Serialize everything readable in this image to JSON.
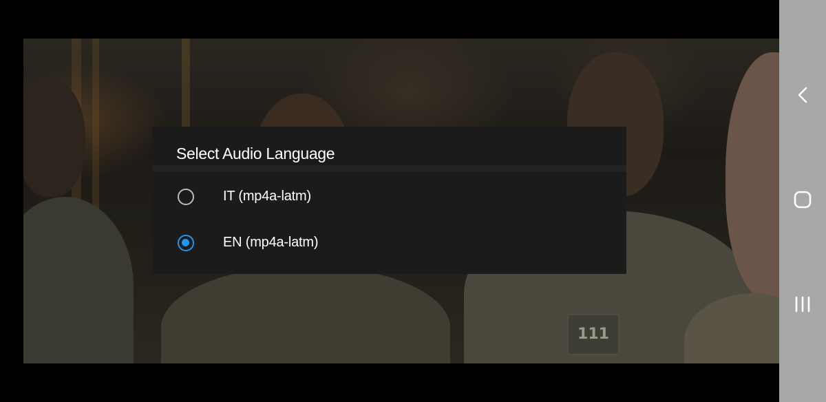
{
  "dialog": {
    "title": "Select Audio Language",
    "options": [
      {
        "label": "IT (mp4a-latm)",
        "selected": false
      },
      {
        "label": "EN (mp4a-latm)",
        "selected": true
      }
    ]
  },
  "video": {
    "overlay_text": "111"
  },
  "navbar": {
    "back_icon": "back-chevron-icon",
    "home_icon": "home-square-icon",
    "recents_icon": "recents-bars-icon"
  },
  "colors": {
    "accent": "#2196f3",
    "dialog_bg": "#1b1b1b",
    "navbar_bg": "#a8a8a8"
  }
}
